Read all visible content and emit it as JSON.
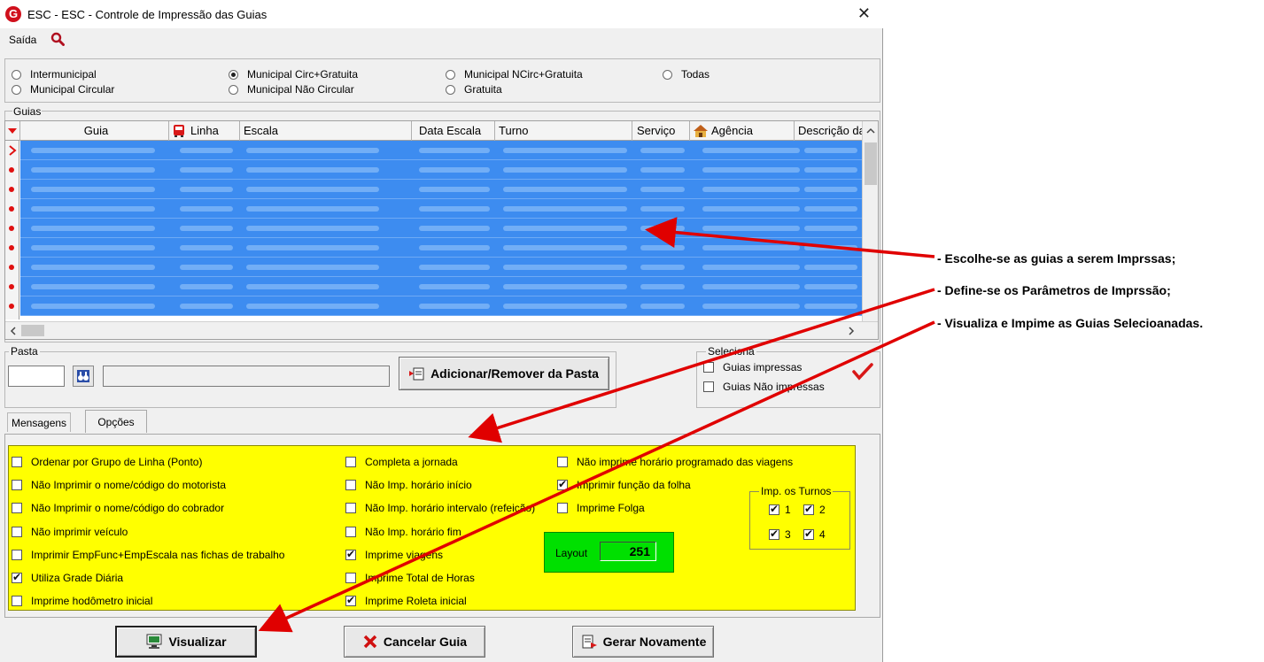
{
  "window": {
    "title": "ESC -  ESC - Controle de Impressão das Guias",
    "logo_letter": "G",
    "close": "✕"
  },
  "menu": {
    "saida": "Saída"
  },
  "radios": {
    "intermunicipal": "Intermunicipal",
    "municipal_circular": "Municipal Circular",
    "municipal_circ_gratuita": "Municipal Circ+Gratuita",
    "municipal_nao_circular": "Municipal Não Circular",
    "municipal_ncirc_gratuita": "Municipal NCirc+Gratuita",
    "gratuita": "Gratuita",
    "todas": "Todas",
    "selected": "municipal_circ_gratuita"
  },
  "grid": {
    "group_label": "Guias",
    "columns": [
      "Guia",
      "Linha",
      "Escala",
      "Data Escala",
      "Turno",
      "Serviço",
      "Agência",
      "Descrição da"
    ],
    "row_count": 9
  },
  "pasta": {
    "label": "Pasta",
    "add_remove_button": "Adicionar/Remover da Pasta"
  },
  "seleciona": {
    "label": "Seleciona",
    "guias_impressas": "Guias impressas",
    "guias_nao_impressas": "Guias Não impressas"
  },
  "tabs": {
    "mensagens": "Mensagens",
    "opcoes": "Opções"
  },
  "options": {
    "col1": [
      {
        "label": "Ordenar por Grupo de Linha (Ponto)",
        "checked": false
      },
      {
        "label": "Não Imprimir o nome/código do motorista",
        "checked": false
      },
      {
        "label": "Não Imprimir o nome/código do cobrador",
        "checked": false
      },
      {
        "label": "Não imprimir veículo",
        "checked": false
      },
      {
        "label": "Imprimir EmpFunc+EmpEscala nas fichas de trabalho",
        "checked": false
      },
      {
        "label": "Utiliza Grade Diária",
        "checked": true
      },
      {
        "label": "Imprime hodômetro inicial",
        "checked": false
      }
    ],
    "col2": [
      {
        "label": "Completa a jornada",
        "checked": false
      },
      {
        "label": "Não Imp. horário início",
        "checked": false
      },
      {
        "label": "Não Imp. horário intervalo (refeição)",
        "checked": false
      },
      {
        "label": "Não Imp. horário fim",
        "checked": false
      },
      {
        "label": "Imprime viagens",
        "checked": true
      },
      {
        "label": "Imprime Total de Horas",
        "checked": false
      },
      {
        "label": "Imprime Roleta inicial",
        "checked": true
      }
    ],
    "col3": [
      {
        "label": "Não imprime horário programado das viagens",
        "checked": false
      },
      {
        "label": "Imprimir função da folha",
        "checked": true
      },
      {
        "label": "Imprime Folga",
        "checked": false
      }
    ]
  },
  "turnos": {
    "label": "Imp. os Turnos",
    "t1": "1",
    "t2": "2",
    "t3": "3",
    "t4": "4"
  },
  "layout": {
    "label": "Layout",
    "value": "251"
  },
  "buttons": {
    "visualizar": "Visualizar",
    "cancelar": "Cancelar Guia",
    "gerar": "Gerar Novamente"
  },
  "annotations": {
    "a1": "- Escolhe-se as guias a serem Imprssas;",
    "a2": "- Define-se os Parâmetros de Imprssão;",
    "a3": "- Visualiza e Impime as Guias Selecioanadas."
  },
  "colors": {
    "selection": "#3d8cf0",
    "options_bg": "#ffff00",
    "layout_bg": "#00e000",
    "arrow": "#e00000"
  }
}
